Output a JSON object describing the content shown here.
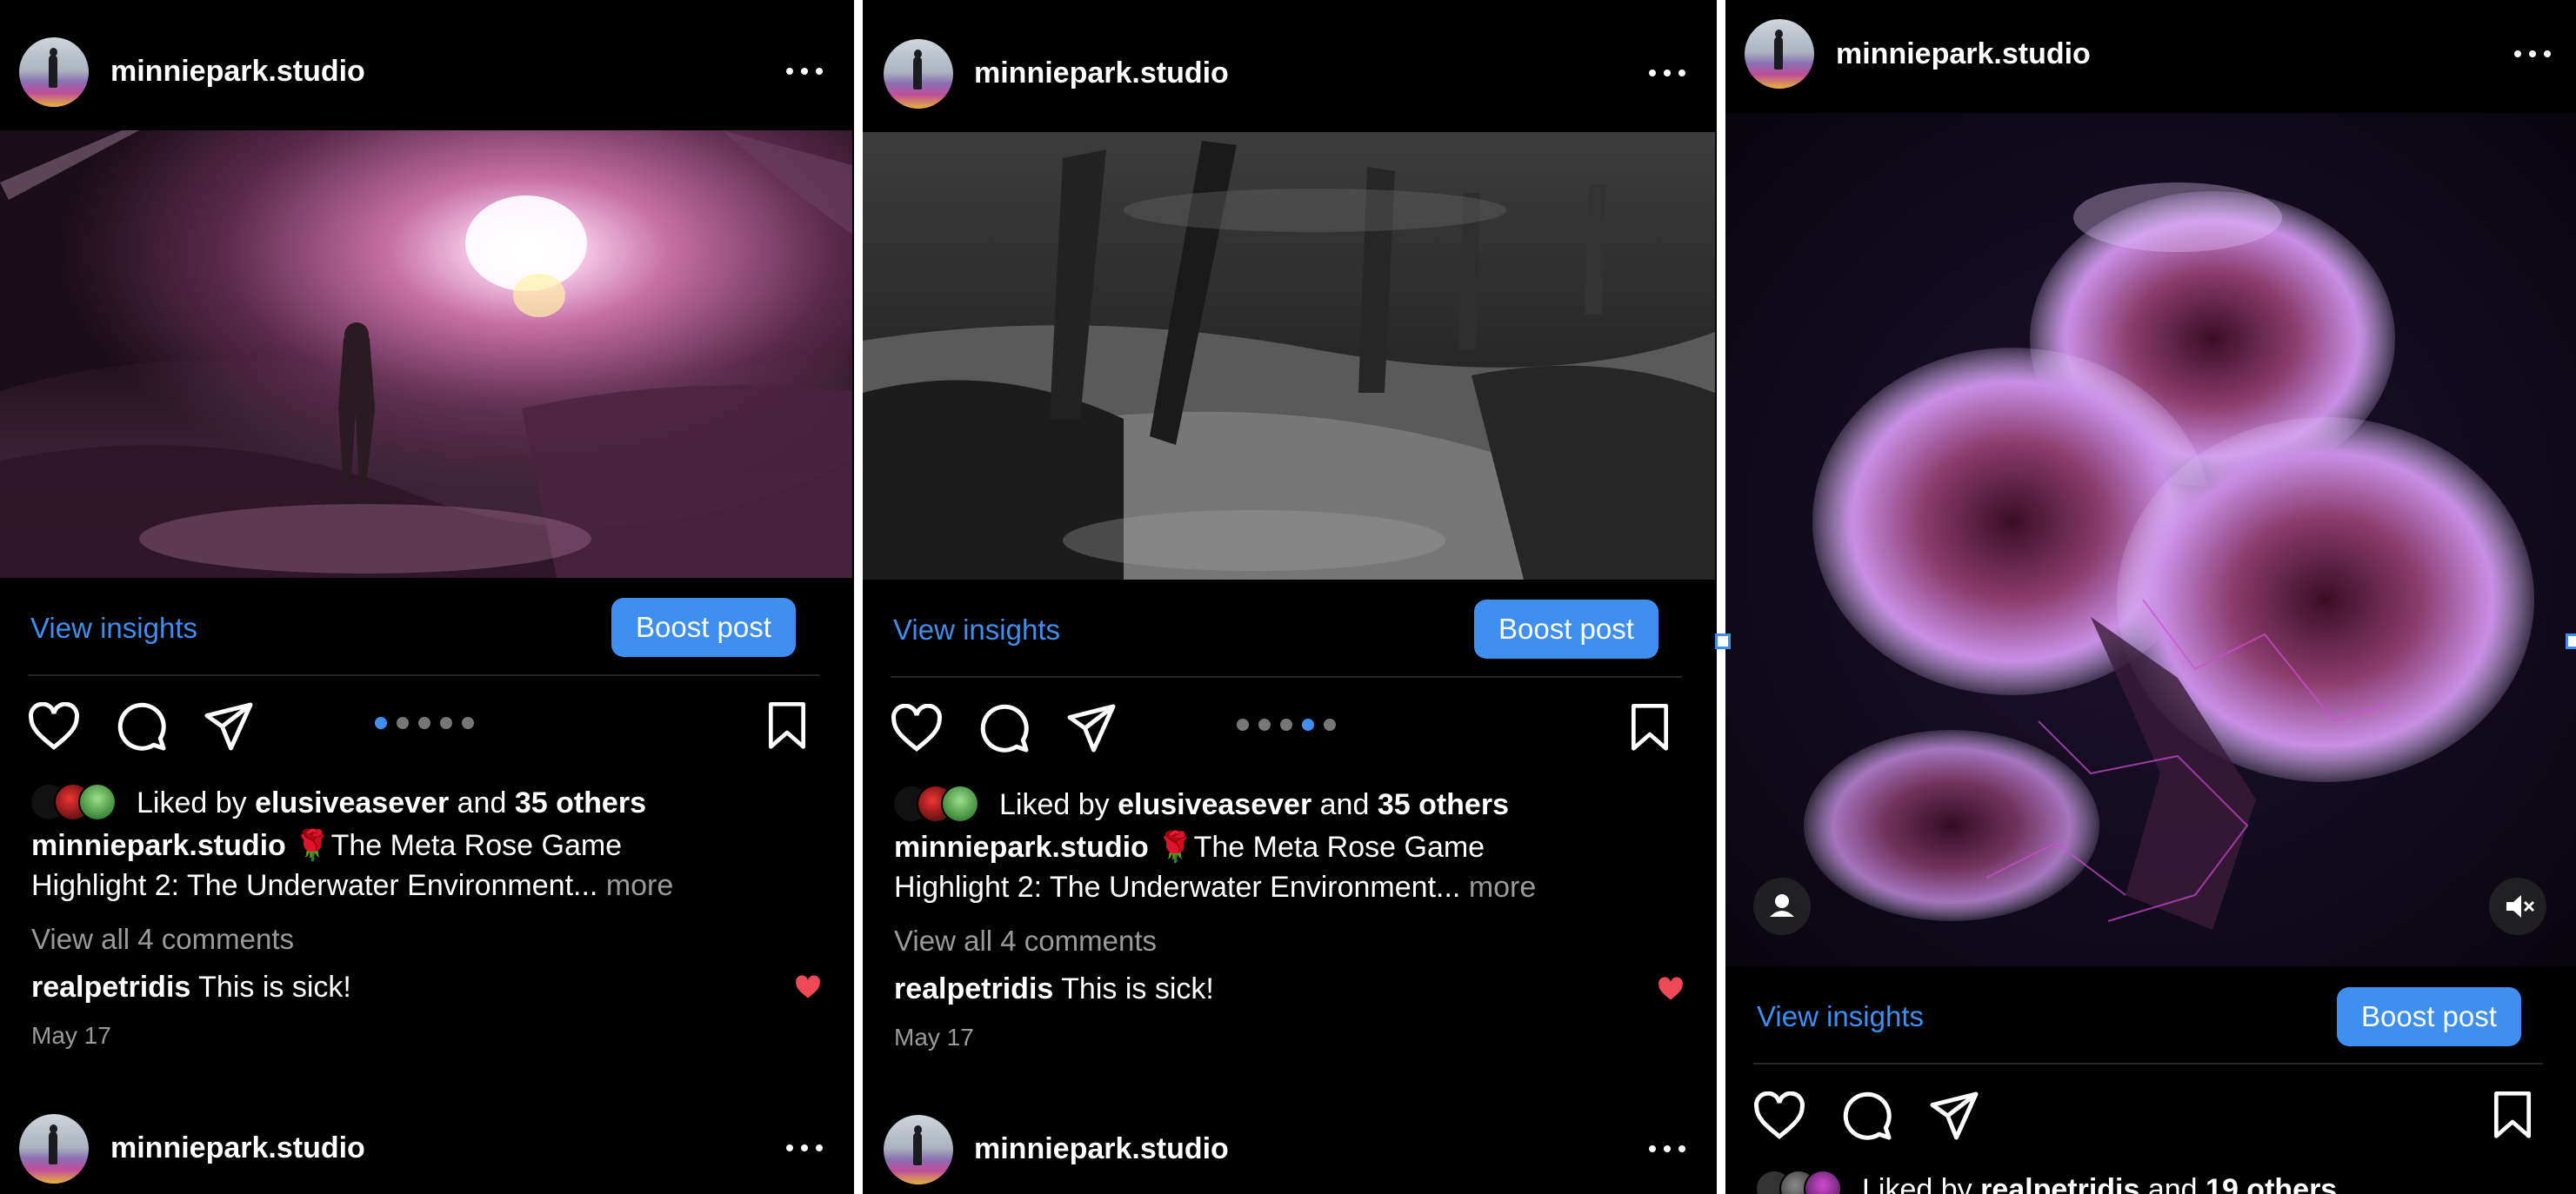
{
  "panels": [
    {
      "header": {
        "username": "minniepark.studio"
      },
      "insights_label": "View insights",
      "boost_label": "Boost post",
      "pager": {
        "count": 5,
        "active": 0
      },
      "liked": {
        "prefix": "Liked by",
        "user": "elusiveasever",
        "and": "and",
        "others": "35 others"
      },
      "caption": {
        "user": "minniepark.studio",
        "text_line1": "🌹The Meta Rose Game",
        "text_line2": "Highlight 2: The Underwater Environment...",
        "more": "more"
      },
      "view_comments": "View all 4 comments",
      "comment": {
        "user": "realpetridis",
        "text": "This is sick!"
      },
      "date": "May 17",
      "next_header": {
        "username": "minniepark.studio"
      }
    },
    {
      "header": {
        "username": "minniepark.studio"
      },
      "insights_label": "View insights",
      "boost_label": "Boost post",
      "pager": {
        "count": 5,
        "active": 3
      },
      "liked": {
        "prefix": "Liked by",
        "user": "elusiveasever",
        "and": "and",
        "others": "35 others"
      },
      "caption": {
        "user": "minniepark.studio",
        "text_line1": "🌹The Meta Rose Game",
        "text_line2": "Highlight 2: The Underwater Environment...",
        "more": "more"
      },
      "view_comments": "View all 4 comments",
      "comment": {
        "user": "realpetridis",
        "text": "This is sick!"
      },
      "date": "May 17",
      "next_header": {
        "username": "minniepark.studio"
      }
    },
    {
      "header": {
        "username": "minniepark.studio"
      },
      "insights_label": "View insights",
      "boost_label": "Boost post",
      "liked": {
        "prefix": "Liked by",
        "user": "realpetridis",
        "and": "and",
        "others": "19 others"
      }
    }
  ],
  "icons": {
    "like": "heart-icon",
    "comment": "comment-icon",
    "share": "paper-plane-icon",
    "save": "bookmark-icon",
    "more": "more-options-icon",
    "tag_people": "person-icon",
    "mute": "speaker-muted-icon",
    "liked_comment": "heart-filled-icon"
  },
  "colors": {
    "accent": "#3f8ff0",
    "background": "#000000",
    "muted_text": "#9a9a9a",
    "like_red": "#ed4956"
  }
}
